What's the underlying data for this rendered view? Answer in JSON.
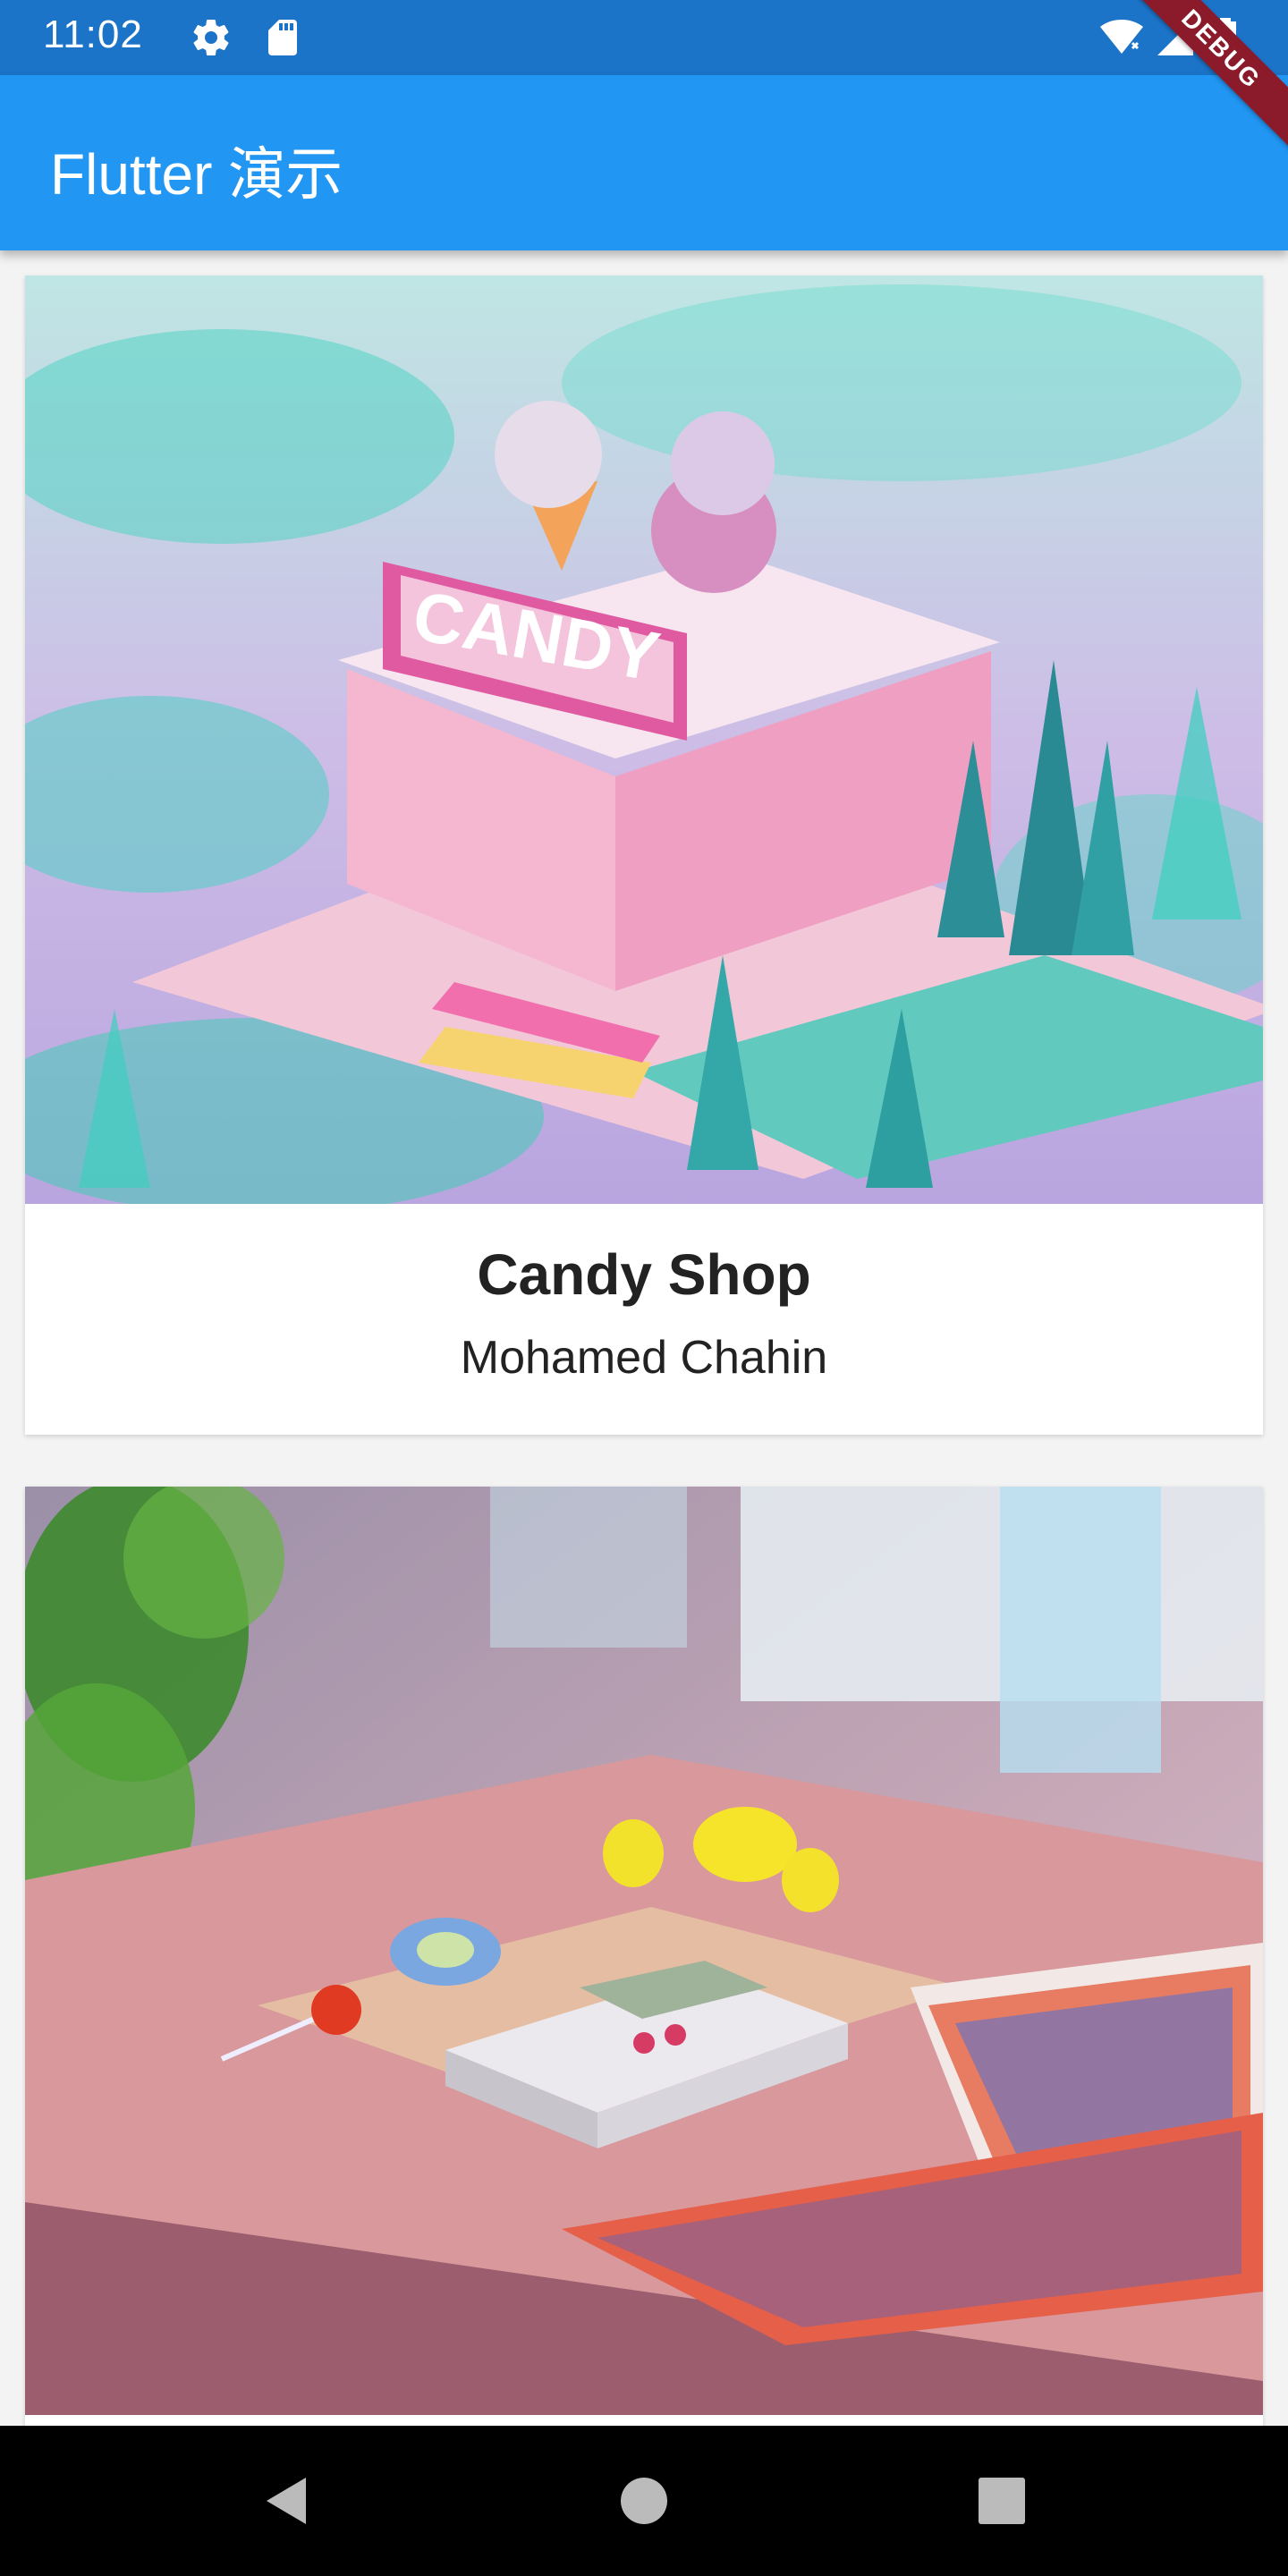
{
  "status_bar": {
    "time": "11:02",
    "left_icons": [
      "gear-icon",
      "sd-card-icon"
    ],
    "right_icons": [
      "wifi-icon",
      "signal-icon",
      "battery-charging-icon"
    ]
  },
  "app_bar": {
    "title": "Flutter 演示",
    "background_color": "#2196f3"
  },
  "debug_banner": {
    "label": "DEBUG"
  },
  "cards": [
    {
      "image": "candy-shop-illustration",
      "title": "Candy Shop",
      "author": "Mohamed Chahin"
    },
    {
      "image": "retro-desk-illustration"
    }
  ],
  "nav_bar": {
    "buttons": [
      "back-icon",
      "home-icon",
      "recents-icon"
    ]
  }
}
